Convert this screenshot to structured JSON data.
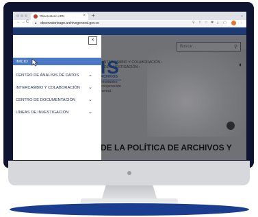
{
  "browser": {
    "tab_title": "Observatorio ADN",
    "tab_close": "×",
    "new_tab": "+",
    "tab_chevron": "⌄",
    "nav_back": "←",
    "nav_forward": "→",
    "nav_reload": "C",
    "url": "observatorioagn.archivogeneral.gov.co",
    "toolbar_icons": [
      "⚲",
      "⇪",
      "☆",
      "✱",
      "⤓",
      "▢",
      "⋮"
    ]
  },
  "menu": {
    "close": "×",
    "items": [
      {
        "label": "INICIO",
        "active": true
      },
      {
        "label": "CENTRO DE ANÁLISIS DE DATOS",
        "chevron": "⌄"
      },
      {
        "label": "INTERCAMBIO Y COLABORACIÓN",
        "chevron": "⌄"
      },
      {
        "label": "CENTRO DE DOCUMENTACIÓN",
        "chevron": "⌄"
      },
      {
        "label": "LÍNEAS DE INVESTIGACIÓN",
        "chevron": "⌄"
      }
    ]
  },
  "page": {
    "search_placeholder": "Buscar...",
    "search_icon": "⚲",
    "breadcrumb_line1": "›  INTERCAMBIO Y COLABORACIÓN ›",
    "breadcrumb_line2": "S DE INVESTIGACIÓN ›",
    "brand_text": "IS",
    "brand_sub1": "RCHIVOS",
    "brand_sub2": "ctividades",
    "brand_sub3": "cooperación",
    "brand_sub4": "nental.",
    "headline": "DE LA POLÍTICA DE ARCHIVOS Y",
    "contrast_icon": "◐"
  },
  "colors": {
    "monitor": "#0f1430",
    "base": "#1a3d8f",
    "accent": "#4a78c6",
    "header": "#1d3b72"
  }
}
